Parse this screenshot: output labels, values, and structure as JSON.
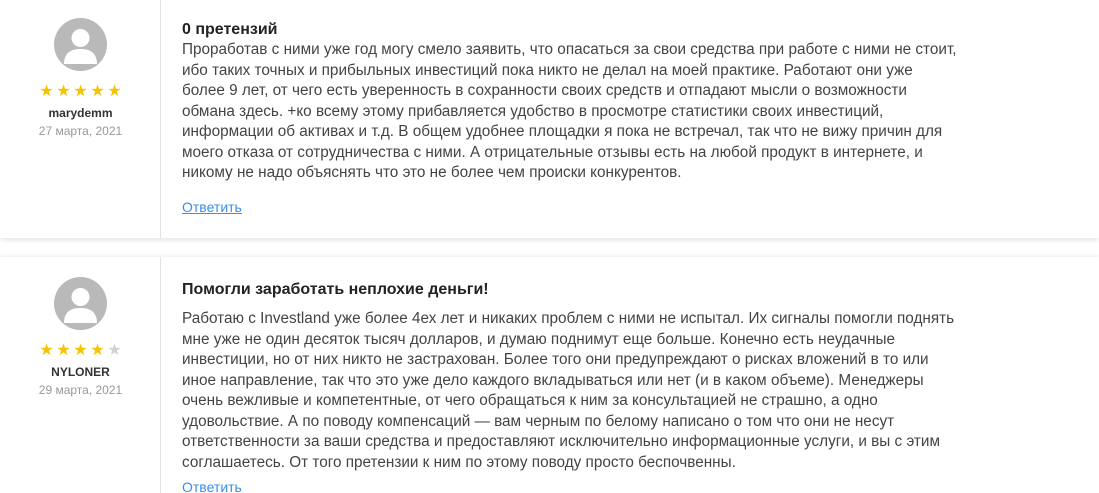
{
  "reviews": [
    {
      "username": "marydemm",
      "date": "27 марта, 2021",
      "rating": 5,
      "title": "0 претензий",
      "lines": [
        "Проработав с ними уже год могу смело заявить, что опасаться за свои средства при работе с ними не стоит,",
        "ибо таких точных и прибыльных инвестиций пока никто не делал на моей практике. Работают они уже",
        "более 9 лет, от чего есть уверенность в сохранности своих средств и отпадают мысли о возможности",
        "обмана здесь. +ко всему этому прибавляется удобство в просмотре статистики своих инвестиций,",
        "информации об активах и т.д. В общем удобнее площадки я пока не встречал, так что не вижу причин для",
        "моего отказа от сотрудничества с ними. А отрицательные отзывы есть на любой продукт в интернете, и",
        "никому не надо объяснять что это не более чем происки конкурентов."
      ],
      "reply_label": "Ответить"
    },
    {
      "username": "NYLONER",
      "date": "29 марта, 2021",
      "rating": 4,
      "title": "Помогли заработать неплохие деньги!",
      "lines": [
        "Работаю с Investland уже более 4ех лет и никаких проблем с ними не испытал. Их сигналы помогли поднять",
        "мне уже не один десяток тысяч долларов, и думаю поднимут еще больше. Конечно есть неудачные",
        "инвестиции, но от них никто не застрахован. Более того они предупреждают о рисках вложений в то или",
        "иное направление, так что это уже дело каждого вкладываться или нет (и в каком объеме). Менеджеры",
        "очень вежливые и компетентные, от чего обращаться к ним за консультацией не страшно, а одно",
        "удовольствие. А по поводу компенсаций — вам черным по белому написано о том что они не несут",
        "ответственности за ваши средства и предоставляют исключительно информационные услуги, и вы с этим",
        "соглашаетесь. От того претензии к ним по этому поводу просто беспочвенны."
      ],
      "reply_label": "Ответить"
    }
  ],
  "icons": {
    "avatar": "user-avatar-icon",
    "star_on": "star-filled-icon",
    "star_off": "star-empty-icon"
  },
  "colors": {
    "star": "#f4c400",
    "star_off": "#d2d2d2",
    "link": "#3a8ee6",
    "avatar_bg": "#b9b9b9"
  }
}
